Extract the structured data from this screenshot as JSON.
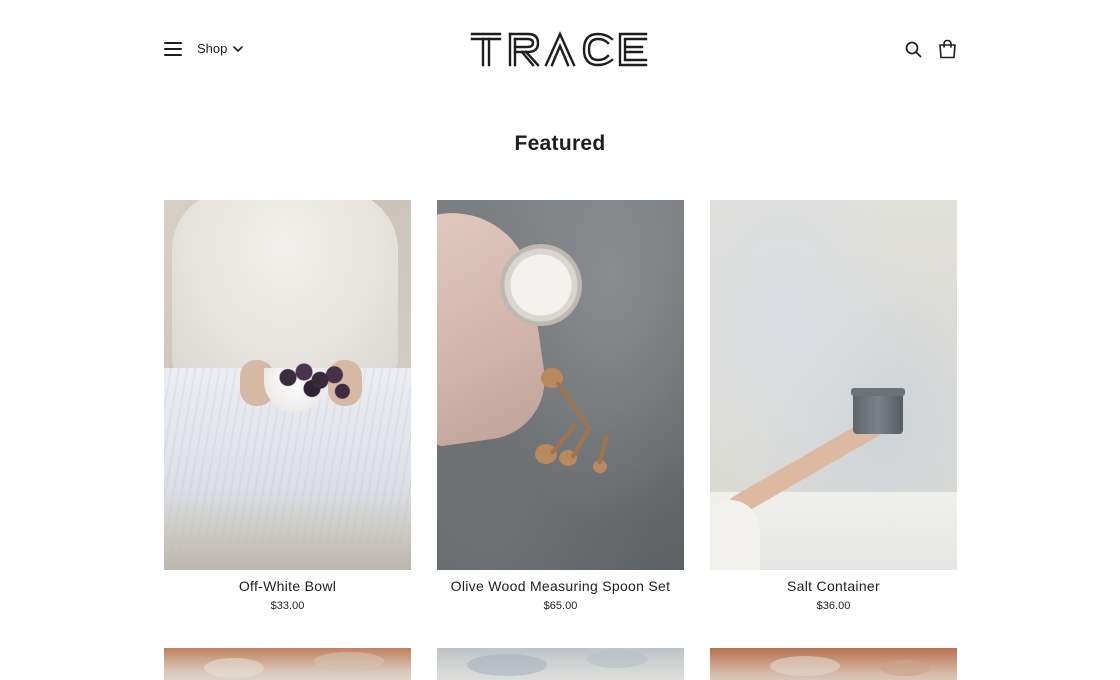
{
  "header": {
    "menu_label": "Menu",
    "shop_label": "Shop",
    "brand": "TRACE"
  },
  "section": {
    "title": "Featured"
  },
  "products": [
    {
      "name": "Off-White Bowl",
      "price": "$33.00"
    },
    {
      "name": "Olive Wood Measuring Spoon Set",
      "price": "$65.00"
    },
    {
      "name": "Salt Container",
      "price": "$36.00"
    }
  ],
  "icons": {
    "menu": "hamburger-icon",
    "shop_dropdown": "chevron-down-icon",
    "search": "search-icon",
    "cart": "shopping-bag-icon"
  },
  "colors": {
    "text": "#1e1e1e",
    "background": "#ffffff"
  }
}
